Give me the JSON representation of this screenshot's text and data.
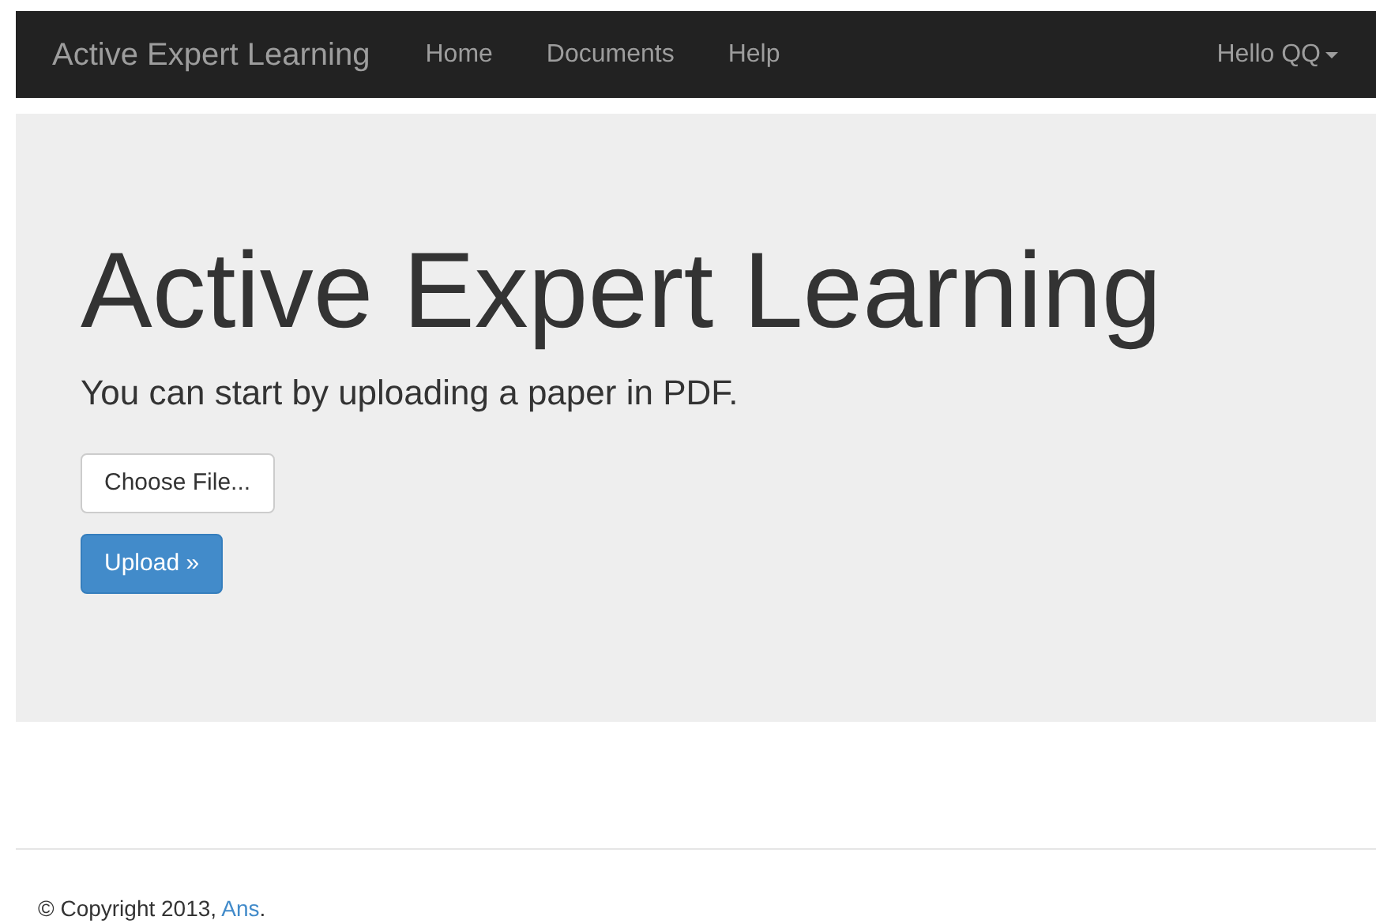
{
  "navbar": {
    "brand": "Active Expert Learning",
    "links": [
      {
        "label": "Home"
      },
      {
        "label": "Documents"
      },
      {
        "label": "Help"
      }
    ],
    "user_menu": "Hello QQ"
  },
  "jumbotron": {
    "title": "Active Expert Learning",
    "lead": "You can start by uploading a paper in PDF.",
    "file_button": "Choose File...",
    "upload_button": "Upload »"
  },
  "footer": {
    "text_before": "© Copyright 2013,",
    "link": "Ans",
    "text_after": "."
  }
}
